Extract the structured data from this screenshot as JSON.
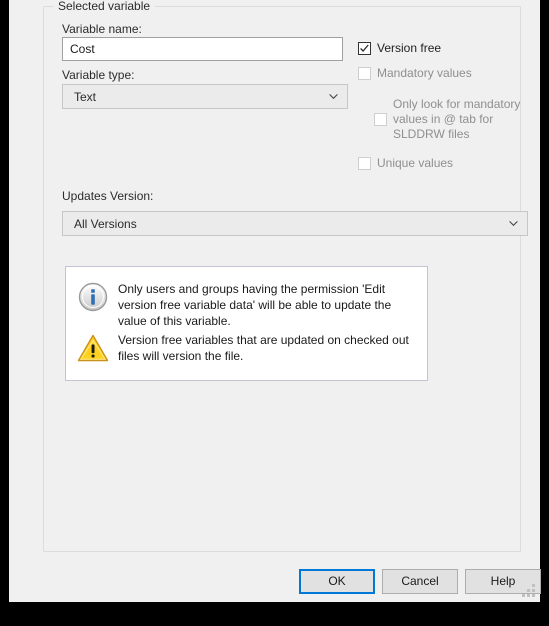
{
  "dialog": {
    "group_title": "Selected variable"
  },
  "fields": {
    "variable_name_label": "Variable name:",
    "variable_name_value": "Cost",
    "variable_name_placeholder": "",
    "variable_type_label": "Variable type:",
    "variable_type_value": "Text",
    "updates_version_label": "Updates Version:",
    "updates_version_value": "All Versions"
  },
  "checkboxes": [
    {
      "label": "Version free",
      "checked": true,
      "enabled": true
    },
    {
      "label": "Mandatory values",
      "checked": false,
      "enabled": false
    },
    {
      "label": "Only look for mandatory values in @ tab for SLDDRW files",
      "checked": false,
      "enabled": false
    },
    {
      "label": "Unique values",
      "checked": false,
      "enabled": false
    }
  ],
  "info": {
    "note_icon": "info-icon",
    "note_text": "Only users and groups having the permission 'Edit version free variable data' will be able to update the value of this variable.",
    "warning_icon": "warning-icon",
    "warning_text": "Version free variables that are updated on checked out files will version the file."
  },
  "buttons": {
    "ok": "OK",
    "cancel": "Cancel",
    "help": "Help"
  },
  "colors": {
    "accent": "#0078d7",
    "dialog_bg": "#f0f0f0",
    "info_border": "#c3c3d4",
    "warning": "#ffd21f",
    "disabled_text": "#8f8f8f"
  }
}
